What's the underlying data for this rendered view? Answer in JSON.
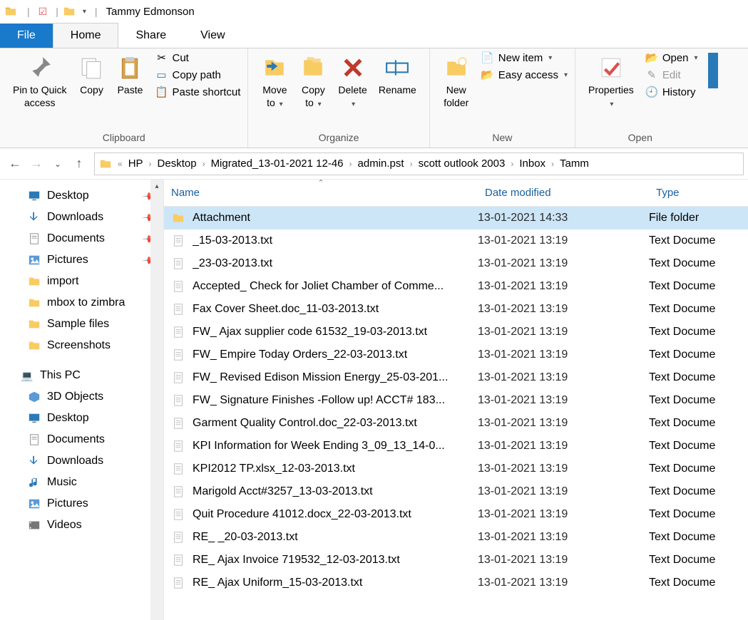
{
  "window_title": "Tammy Edmonson",
  "tabs": {
    "file": "File",
    "home": "Home",
    "share": "Share",
    "view": "View"
  },
  "ribbon": {
    "clipboard": {
      "label": "Clipboard",
      "pin": "Pin to Quick\naccess",
      "copy": "Copy",
      "paste": "Paste",
      "cut": "Cut",
      "copy_path": "Copy path",
      "paste_shortcut": "Paste shortcut"
    },
    "organize": {
      "label": "Organize",
      "move_to": "Move\nto",
      "copy_to": "Copy\nto",
      "delete": "Delete",
      "rename": "Rename"
    },
    "new": {
      "label": "New",
      "new_folder": "New\nfolder",
      "new_item": "New item",
      "easy_access": "Easy access"
    },
    "open": {
      "label": "Open",
      "properties": "Properties",
      "open": "Open",
      "edit": "Edit",
      "history": "History"
    }
  },
  "breadcrumb": [
    "HP",
    "Desktop",
    "Migrated_13-01-2021 12-46",
    "admin.pst",
    "scott outlook 2003",
    "Inbox",
    "Tamm"
  ],
  "tree": {
    "quick": [
      {
        "label": "Desktop",
        "icon": "desktop",
        "pinned": true
      },
      {
        "label": "Downloads",
        "icon": "download",
        "pinned": true
      },
      {
        "label": "Documents",
        "icon": "document",
        "pinned": true
      },
      {
        "label": "Pictures",
        "icon": "picture",
        "pinned": true
      },
      {
        "label": "import",
        "icon": "folder",
        "pinned": false
      },
      {
        "label": "mbox to zimbra",
        "icon": "folder",
        "pinned": false
      },
      {
        "label": "Sample files",
        "icon": "folder",
        "pinned": false
      },
      {
        "label": "Screenshots",
        "icon": "folder",
        "pinned": false
      }
    ],
    "this_pc_label": "This PC",
    "this_pc": [
      {
        "label": "3D Objects",
        "icon": "3d"
      },
      {
        "label": "Desktop",
        "icon": "desktop"
      },
      {
        "label": "Documents",
        "icon": "document"
      },
      {
        "label": "Downloads",
        "icon": "download"
      },
      {
        "label": "Music",
        "icon": "music"
      },
      {
        "label": "Pictures",
        "icon": "picture"
      },
      {
        "label": "Videos",
        "icon": "video"
      }
    ]
  },
  "columns": {
    "name": "Name",
    "date": "Date modified",
    "type": "Type"
  },
  "files": [
    {
      "name": "Attachment",
      "date": "13-01-2021 14:33",
      "type": "File folder",
      "icon": "folder",
      "selected": true
    },
    {
      "name": "_15-03-2013.txt",
      "date": "13-01-2021 13:19",
      "type": "Text Docume",
      "icon": "txt"
    },
    {
      "name": "_23-03-2013.txt",
      "date": "13-01-2021 13:19",
      "type": "Text Docume",
      "icon": "txt"
    },
    {
      "name": "Accepted_ Check for Joliet Chamber of Comme...",
      "date": "13-01-2021 13:19",
      "type": "Text Docume",
      "icon": "txt"
    },
    {
      "name": "Fax Cover Sheet.doc_11-03-2013.txt",
      "date": "13-01-2021 13:19",
      "type": "Text Docume",
      "icon": "txt"
    },
    {
      "name": "FW_ Ajax supplier code 61532_19-03-2013.txt",
      "date": "13-01-2021 13:19",
      "type": "Text Docume",
      "icon": "txt"
    },
    {
      "name": "FW_ Empire Today Orders_22-03-2013.txt",
      "date": "13-01-2021 13:19",
      "type": "Text Docume",
      "icon": "txt"
    },
    {
      "name": "FW_ Revised Edison Mission Energy_25-03-201...",
      "date": "13-01-2021 13:19",
      "type": "Text Docume",
      "icon": "txt"
    },
    {
      "name": "FW_ Signature Finishes -Follow up! ACCT# 183...",
      "date": "13-01-2021 13:19",
      "type": "Text Docume",
      "icon": "txt"
    },
    {
      "name": "Garment Quality Control.doc_22-03-2013.txt",
      "date": "13-01-2021 13:19",
      "type": "Text Docume",
      "icon": "txt"
    },
    {
      "name": "KPI Information for Week Ending 3_09_13_14-0...",
      "date": "13-01-2021 13:19",
      "type": "Text Docume",
      "icon": "txt"
    },
    {
      "name": "KPI2012 TP.xlsx_12-03-2013.txt",
      "date": "13-01-2021 13:19",
      "type": "Text Docume",
      "icon": "txt"
    },
    {
      "name": "Marigold Acct#3257_13-03-2013.txt",
      "date": "13-01-2021 13:19",
      "type": "Text Docume",
      "icon": "txt"
    },
    {
      "name": "Quit Procedure 41012.docx_22-03-2013.txt",
      "date": "13-01-2021 13:19",
      "type": "Text Docume",
      "icon": "txt"
    },
    {
      "name": "RE_ _20-03-2013.txt",
      "date": "13-01-2021 13:19",
      "type": "Text Docume",
      "icon": "txt"
    },
    {
      "name": "RE_ Ajax Invoice 719532_12-03-2013.txt",
      "date": "13-01-2021 13:19",
      "type": "Text Docume",
      "icon": "txt"
    },
    {
      "name": "RE_ Ajax Uniform_15-03-2013.txt",
      "date": "13-01-2021 13:19",
      "type": "Text Docume",
      "icon": "txt"
    }
  ]
}
